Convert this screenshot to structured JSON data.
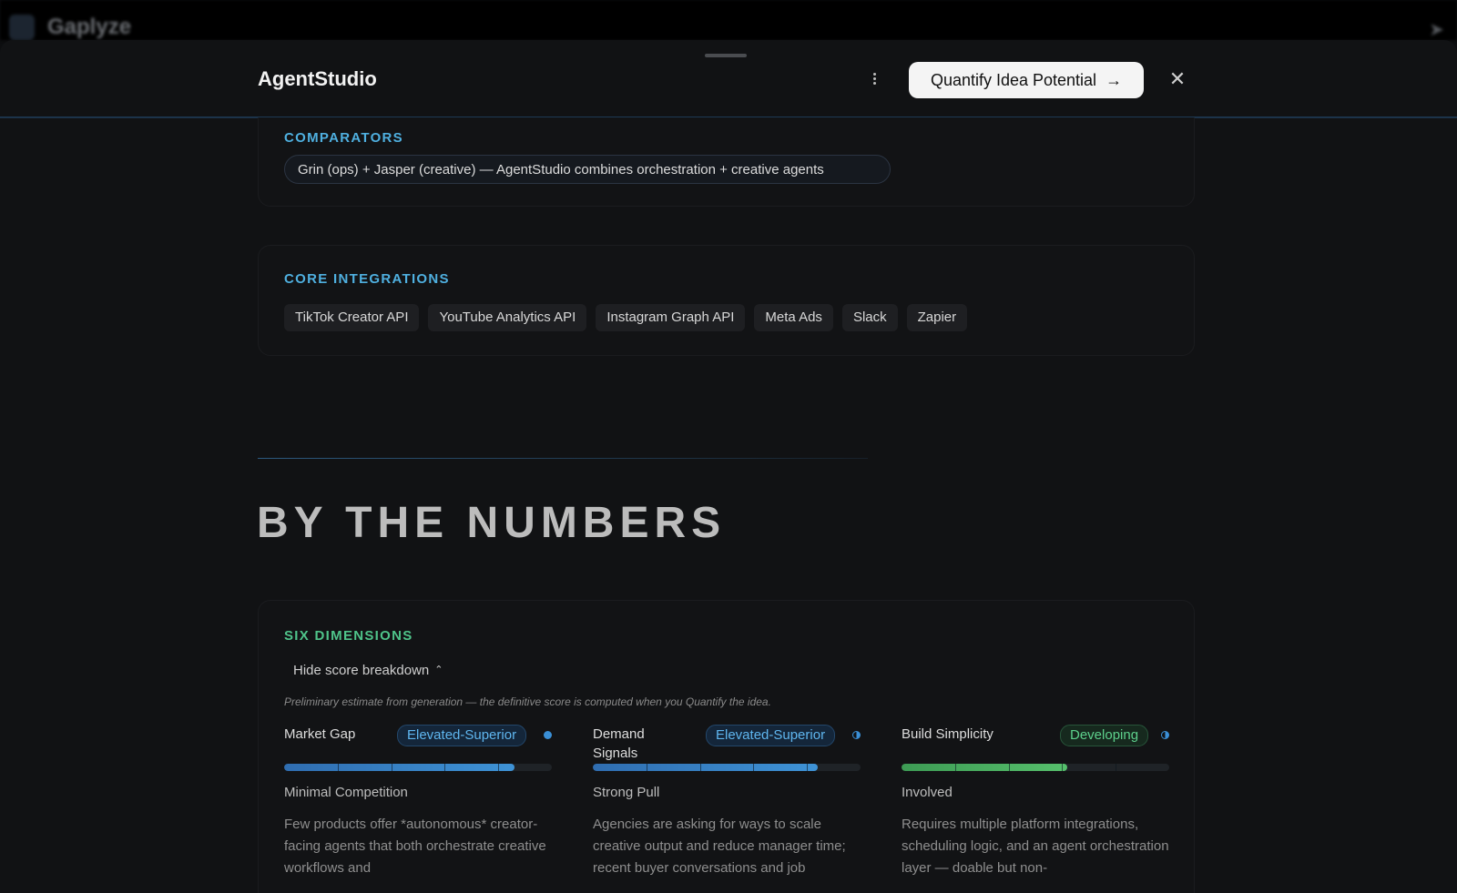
{
  "background": {
    "app_name": "Gaplyze"
  },
  "header": {
    "title": "AgentStudio",
    "cta_label": "Quantify Idea Potential",
    "cta_arrow": "→",
    "close_glyph": "✕"
  },
  "comparators": {
    "label": "COMPARATORS",
    "text": "Grin (ops) + Jasper (creative) — AgentStudio combines orchestration + creative agents"
  },
  "integrations": {
    "label": "CORE INTEGRATIONS",
    "items": [
      "TikTok Creator API",
      "YouTube Analytics API",
      "Instagram Graph API",
      "Meta Ads",
      "Slack",
      "Zapier"
    ]
  },
  "numbers": {
    "title": "BY THE NUMBERS",
    "section_label": "SIX DIMENSIONS",
    "toggle_label": "Hide score breakdown",
    "note": "Preliminary estimate from generation — the definitive score is computed when you Quantify the idea.",
    "dimensions": [
      {
        "name": "Market Gap",
        "badge": "Elevated-Superior",
        "level": "Minimal Competition",
        "score_fraction": 0.86,
        "description": "Few products offer *autonomous* creator-facing agents that both orchestrate creative workflows and"
      },
      {
        "name": "Demand Signals",
        "badge": "Elevated-Superior",
        "level": "Strong Pull",
        "score_fraction": 0.84,
        "description": "Agencies are asking for ways to scale creative output and reduce manager time; recent buyer conversations and job"
      },
      {
        "name": "Build Simplicity",
        "badge": "Developing",
        "level": "Involved",
        "score_fraction": 0.62,
        "description": "Requires multiple platform integrations, scheduling logic, and an agent orchestration layer — doable but non-"
      }
    ]
  },
  "colors": {
    "accent_blue": "#4fb0e0",
    "accent_green": "#4fc48a",
    "cta_bg": "#f4f4f4"
  }
}
